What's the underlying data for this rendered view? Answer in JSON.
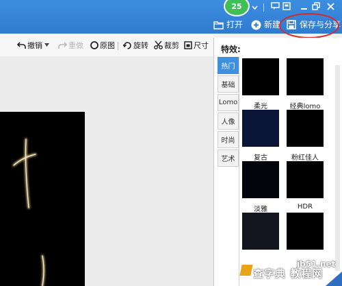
{
  "titlebar": {
    "notification_count": "25",
    "open_label": "打开",
    "new_label": "新建",
    "save_share_label": "保存与分享"
  },
  "toolbar": {
    "undo_label": "撤销",
    "redo_label": "重做",
    "original_label": "原图",
    "rotate_label": "旋转",
    "crop_label": "裁剪",
    "size_label": "尺寸"
  },
  "effects": {
    "title": "特效:",
    "categories": [
      "热门",
      "基础",
      "Lomo",
      "人像",
      "时尚",
      "艺术"
    ],
    "active_category": "热门",
    "items": [
      {
        "label": "柔光",
        "color": "#000000"
      },
      {
        "label": "经典lomo",
        "color": "#000000"
      },
      {
        "label": "复古",
        "color": "#0b1537"
      },
      {
        "label": "粉红佳人",
        "color": "#000000"
      },
      {
        "label": "淡雅",
        "color": "#03050c"
      },
      {
        "label": "HDR",
        "color": "#000000"
      },
      {
        "label": "",
        "color": "#14161f"
      },
      {
        "label": "",
        "color": "#000000"
      }
    ]
  },
  "watermark": {
    "line1": "jb51.net",
    "line2": "查字典 教程网"
  },
  "colors": {
    "titlebar_blue": "#2f7bd0",
    "accent_blue": "#3d8fe0",
    "highlight_red": "#d62a2a",
    "badge_green": "#3fbf55"
  }
}
